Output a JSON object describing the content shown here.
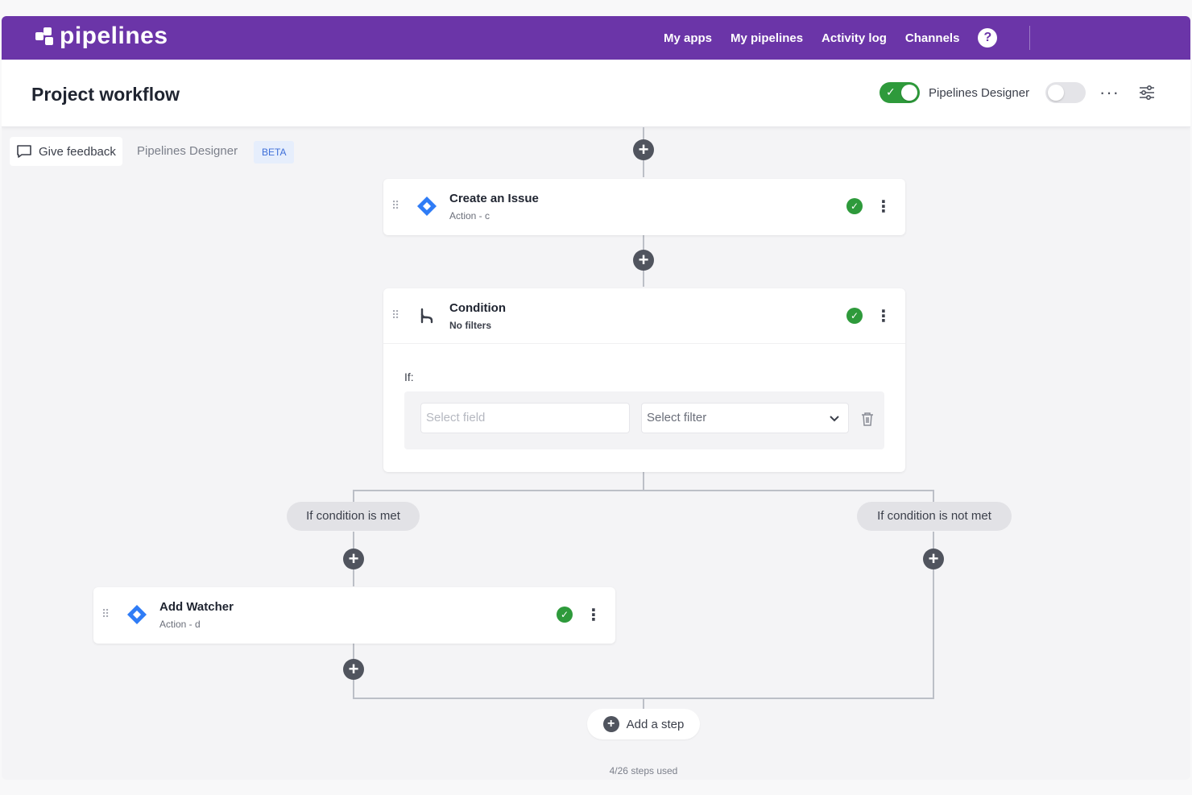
{
  "app": {
    "brand": "pipelines"
  },
  "nav": {
    "items": [
      "My apps",
      "My pipelines",
      "Activity log",
      "Channels"
    ],
    "help_icon": "question-circle-icon",
    "help_glyph": "?"
  },
  "header": {
    "title": "Project workflow",
    "designer_toggle_label": "Pipelines Designer",
    "more_icon": "ellipsis-icon",
    "more_glyph": "···",
    "settings_icon": "sliders-icon"
  },
  "toolbar": {
    "feedback_label": "Give feedback",
    "breadcrumb": "Pipelines Designer",
    "badge": "BETA"
  },
  "steps": [
    {
      "title": "Create an Issue",
      "subtitle": "Action - c",
      "icon": "jira-diamond-icon",
      "status": "ok"
    },
    {
      "title": "Condition",
      "subtitle": "No filters",
      "icon": "branch-icon",
      "status": "ok"
    },
    {
      "title": "Add Watcher",
      "subtitle": "Action - d",
      "icon": "jira-diamond-icon",
      "status": "ok"
    }
  ],
  "condition": {
    "if_label": "If:",
    "field_placeholder": "Select field",
    "filter_placeholder": "Select filter"
  },
  "branches": {
    "met": "If condition is met",
    "not_met": "If condition is not met"
  },
  "footer": {
    "add_step_label": "Add a step",
    "steps_used": "4/26 steps used"
  },
  "colors": {
    "brand": "#6b35a8",
    "success": "#2e9a3b",
    "jira_blue": "#2f7cf6",
    "badge_bg": "#e6eefc",
    "badge_text": "#3e6fd8"
  }
}
